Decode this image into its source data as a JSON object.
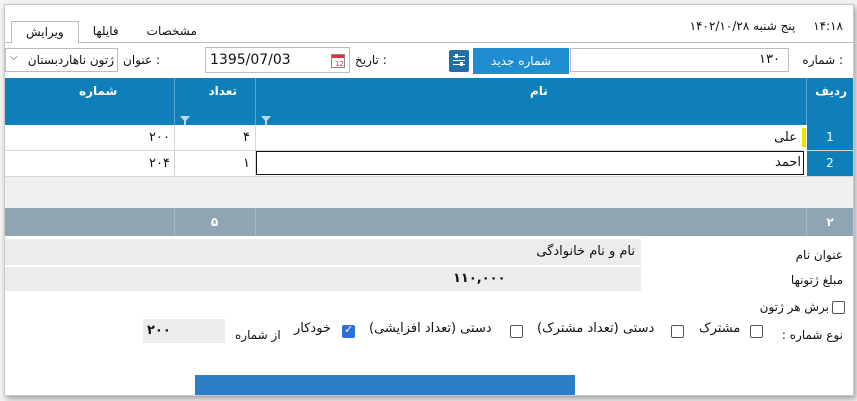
{
  "titlebar": {
    "time": "۱۴:۱۸",
    "date": "پنج شنبه  ۱۴۰۲/۱۰/۲۸"
  },
  "tabs": [
    {
      "label": "ویرایش",
      "active": true
    },
    {
      "label": "فایلها",
      "active": false
    },
    {
      "label": "مشخصات",
      "active": false
    }
  ],
  "form": {
    "number_label": "شماره :",
    "number_value": "۱۳۰",
    "new_number_button": "شماره جدید",
    "date_label": "تاریخ :",
    "date_value": "1395/07/03",
    "title_label": "عنوان :",
    "title_value": "ژتون ناهاردبستان"
  },
  "grid": {
    "columns": [
      "ردیف",
      "نام",
      "تعداد",
      "شماره"
    ],
    "rows": [
      {
        "index": "1",
        "name": "علی",
        "count": "۴",
        "number": "۲۰۰"
      },
      {
        "index": "2",
        "name": "احمد",
        "count": "۱",
        "number": "۲۰۴"
      }
    ],
    "footer": {
      "row_count": "۲",
      "count_total": "۵"
    }
  },
  "details": {
    "name_title_label": "عنوان نام",
    "name_title_value": "نام و نام خانوادگی",
    "amount_label": "مبلغ ژتونها",
    "amount_value": "۱۱۰,۰۰۰",
    "cut_each_label": "برش هر ژتون",
    "numbering_type_label": "نوع شماره :",
    "options": [
      {
        "label": "مشترک",
        "checked": false
      },
      {
        "label": "دستی (تعداد مشترک)",
        "checked": false
      },
      {
        "label": "دستی (تعداد افزایشی)",
        "checked": false
      },
      {
        "label": "خودکار",
        "checked": true
      }
    ],
    "from_number_label": "از شماره",
    "from_number_value": "۲۰۰"
  },
  "colors": {
    "header_blue": "#0e7fb8",
    "button_blue": "#1e8ed0",
    "footer_gray": "#8fa5b1"
  }
}
